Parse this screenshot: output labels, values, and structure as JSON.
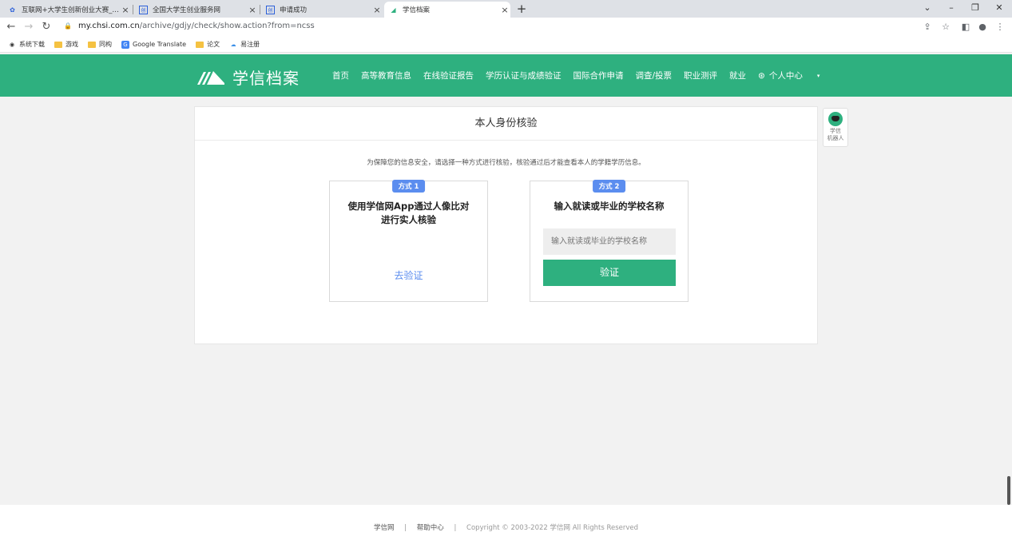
{
  "browser": {
    "tabs": [
      {
        "title": "互联网+大学生创新创业大赛_百…",
        "active": false
      },
      {
        "title": "全国大学生创业服务网",
        "active": false
      },
      {
        "title": "申请成功",
        "active": false
      },
      {
        "title": "学信档案",
        "active": true
      }
    ],
    "url_domain": "my.chsi.com.cn",
    "url_path": "/archive/gdjy/check/show.action?from=ncss",
    "bookmarks": [
      "系统下载",
      "游戏",
      "同构",
      "Google Translate",
      "论文",
      "易注册"
    ]
  },
  "header": {
    "logo_text": "学信档案",
    "nav": [
      "首页",
      "高等教育信息",
      "在线验证报告",
      "学历认证与成绩验证",
      "国际合作申请",
      "调查/投票",
      "职业测评",
      "就业"
    ],
    "user_menu": "个人中心"
  },
  "card": {
    "title": "本人身份核验",
    "description": "为保障您的信息安全，请选择一种方式进行核验，核验通过后才能查看本人的学籍学历信息。",
    "method1": {
      "badge": "方式 1",
      "title_line1": "使用学信网App通过人像比对",
      "title_line2": "进行实人核验",
      "link": "去验证"
    },
    "method2": {
      "badge": "方式 2",
      "title": "输入就读或毕业的学校名称",
      "input_placeholder": "输入就读或毕业的学校名称",
      "button": "验证"
    }
  },
  "robot": {
    "line1": "学信",
    "line2": "机器人"
  },
  "footer": {
    "link1": "学信网",
    "link2": "帮助中心",
    "copyright": "Copyright © 2003-2022 学信网 All Rights Reserved"
  },
  "colors": {
    "brand_green": "#2eb07f",
    "accent_blue": "#5b8def"
  }
}
